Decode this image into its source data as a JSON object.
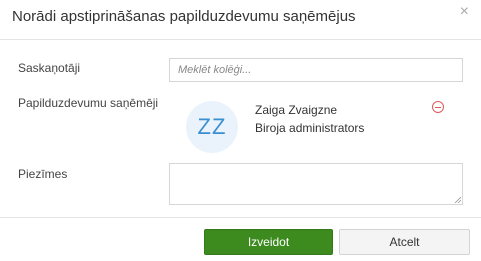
{
  "dialog": {
    "title": "Norādi apstiprināšanas papilduzdevumu saņēmējus",
    "close_icon": "×"
  },
  "form": {
    "coordinators_label": "Saskaņotāji",
    "search_placeholder": "Meklēt kolēģi...",
    "recipients_label": "Papilduzdevumu saņēmēji",
    "recipient": {
      "initials": "ZZ",
      "name": "Zaiga Zvaigzne",
      "role": "Biroja administrators"
    },
    "notes_label": "Piezīmes"
  },
  "footer": {
    "create_label": "Izveidot",
    "cancel_label": "Atcelt"
  },
  "colors": {
    "primary": "#3d8b1f",
    "avatar_bg": "#eaf3fb",
    "avatar_text": "#3a8fd0",
    "remove": "#e05a5a"
  }
}
